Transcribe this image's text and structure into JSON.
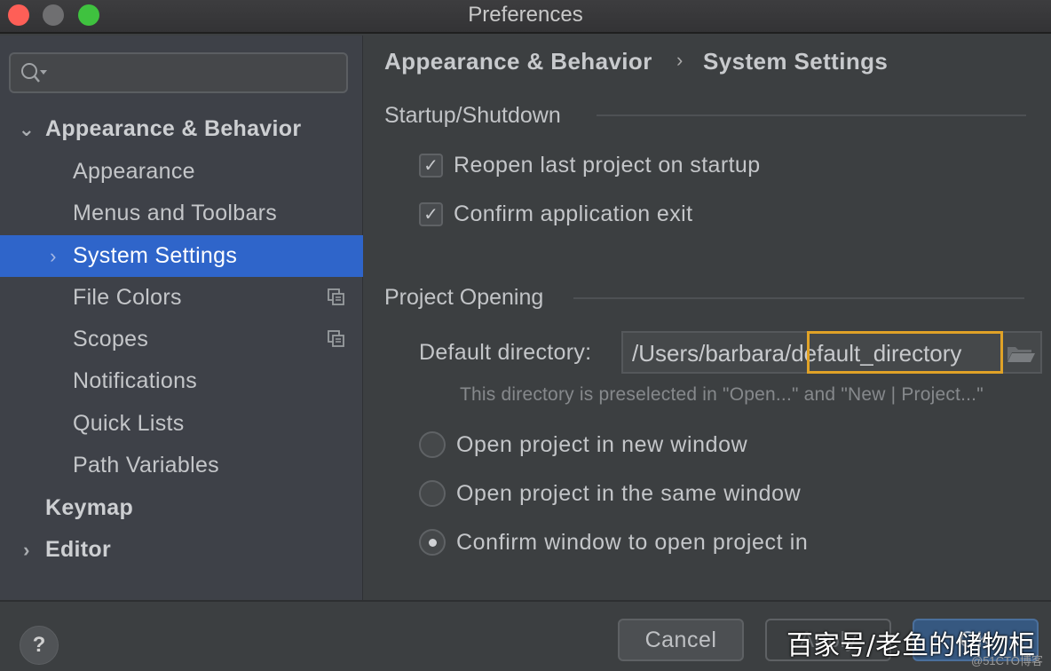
{
  "window": {
    "title": "Preferences"
  },
  "sidebar": {
    "search": {
      "value": "",
      "placeholder": ""
    },
    "items": [
      {
        "label": "Appearance & Behavior",
        "level": 0,
        "bold": true,
        "expanded": true,
        "chevron": "⌄"
      },
      {
        "label": "Appearance",
        "level": 1
      },
      {
        "label": "Menus and Toolbars",
        "level": 1
      },
      {
        "label": "System Settings",
        "level": 1,
        "selected": true,
        "chevron": "›"
      },
      {
        "label": "File Colors",
        "level": 1,
        "icon": "copy-settings-icon"
      },
      {
        "label": "Scopes",
        "level": 1,
        "icon": "copy-settings-icon"
      },
      {
        "label": "Notifications",
        "level": 1
      },
      {
        "label": "Quick Lists",
        "level": 1
      },
      {
        "label": "Path Variables",
        "level": 1
      },
      {
        "label": "Keymap",
        "level": 0,
        "bold": true
      },
      {
        "label": "Editor",
        "level": 0,
        "bold": true,
        "chevron": "›"
      }
    ]
  },
  "main": {
    "breadcrumb": {
      "parent": "Appearance & Behavior",
      "separator": "›",
      "current": "System Settings"
    },
    "startup": {
      "title": "Startup/Shutdown",
      "checkboxes": [
        {
          "label": "Reopen last project on startup",
          "checked": true
        },
        {
          "label": "Confirm application exit",
          "checked": true
        }
      ]
    },
    "project_opening": {
      "title": "Project Opening",
      "default_directory_label": "Default directory:",
      "default_directory_value": "/Users/barbara/default_directory",
      "default_directory_prefix": "/Users/barbara/",
      "default_directory_highlight": "default_directory",
      "hint": "This directory is preselected in \"Open...\" and \"New | Project...\"",
      "radios": [
        {
          "label": "Open project in new window",
          "checked": false
        },
        {
          "label": "Open project in the same window",
          "checked": false
        },
        {
          "label": "Confirm window to open project in",
          "checked": true
        }
      ]
    }
  },
  "footer": {
    "help_label": "?",
    "cancel_label": "Cancel",
    "apply_label": "Apply",
    "ok_label": "OK"
  },
  "overlay": {
    "watermark": "百家号/老鱼的储物柜",
    "watermark_small": "@51CTO博客"
  },
  "colors": {
    "selection": "#2f65ca",
    "highlight_border": "#e0a227",
    "ok_button": "#365880"
  }
}
